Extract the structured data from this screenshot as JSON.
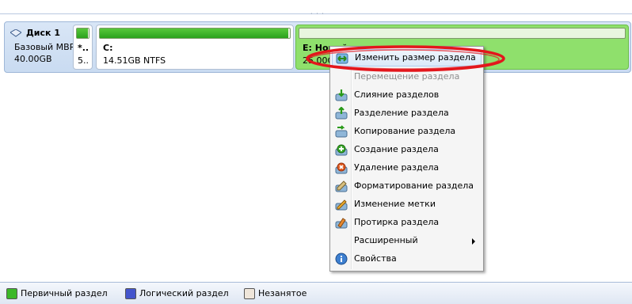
{
  "disk": {
    "name": "Диск 1",
    "type": "Базовый MBR",
    "size": "40.00GB"
  },
  "partitions": [
    {
      "label": "*..",
      "detail": "5..",
      "used_fraction": 0.9
    },
    {
      "label": "C:",
      "detail": "14.51GB NTFS",
      "used_fraction": 0.99
    },
    {
      "label": "E: Новый том",
      "detail": "25.00GB NTFS",
      "used_fraction": 0.0
    }
  ],
  "context_menu": {
    "items": [
      {
        "label": "Изменить размер раздела",
        "icon": "resize-icon",
        "state": "highlighted"
      },
      {
        "label": "Перемещение раздела",
        "icon": "",
        "state": "disabled"
      },
      {
        "label": "Слияние разделов",
        "icon": "merge-icon",
        "state": "normal"
      },
      {
        "label": "Разделение раздела",
        "icon": "split-icon",
        "state": "normal"
      },
      {
        "label": "Копирование раздела",
        "icon": "copy-icon",
        "state": "normal"
      },
      {
        "label": "Создание раздела",
        "icon": "create-icon",
        "state": "normal"
      },
      {
        "label": "Удаление раздела",
        "icon": "delete-icon",
        "state": "normal"
      },
      {
        "label": "Форматирование раздела",
        "icon": "format-icon",
        "state": "normal"
      },
      {
        "label": "Изменение метки",
        "icon": "label-icon",
        "state": "normal"
      },
      {
        "label": "Протирка раздела",
        "icon": "wipe-icon",
        "state": "normal"
      },
      {
        "label": "Расширенный",
        "icon": "",
        "state": "submenu"
      },
      {
        "label": "Свойства",
        "icon": "info-icon",
        "state": "normal"
      }
    ]
  },
  "legend": [
    {
      "label": "Первичный раздел",
      "color": "#3cb82a"
    },
    {
      "label": "Логический раздел",
      "color": "#4455cc"
    },
    {
      "label": "Незанятое",
      "color": "#efe6da"
    }
  ],
  "colors": {
    "primary_partition": "#3cb82a",
    "selected_partition": "#8fe06c",
    "highlight_ring": "#e3161c"
  }
}
